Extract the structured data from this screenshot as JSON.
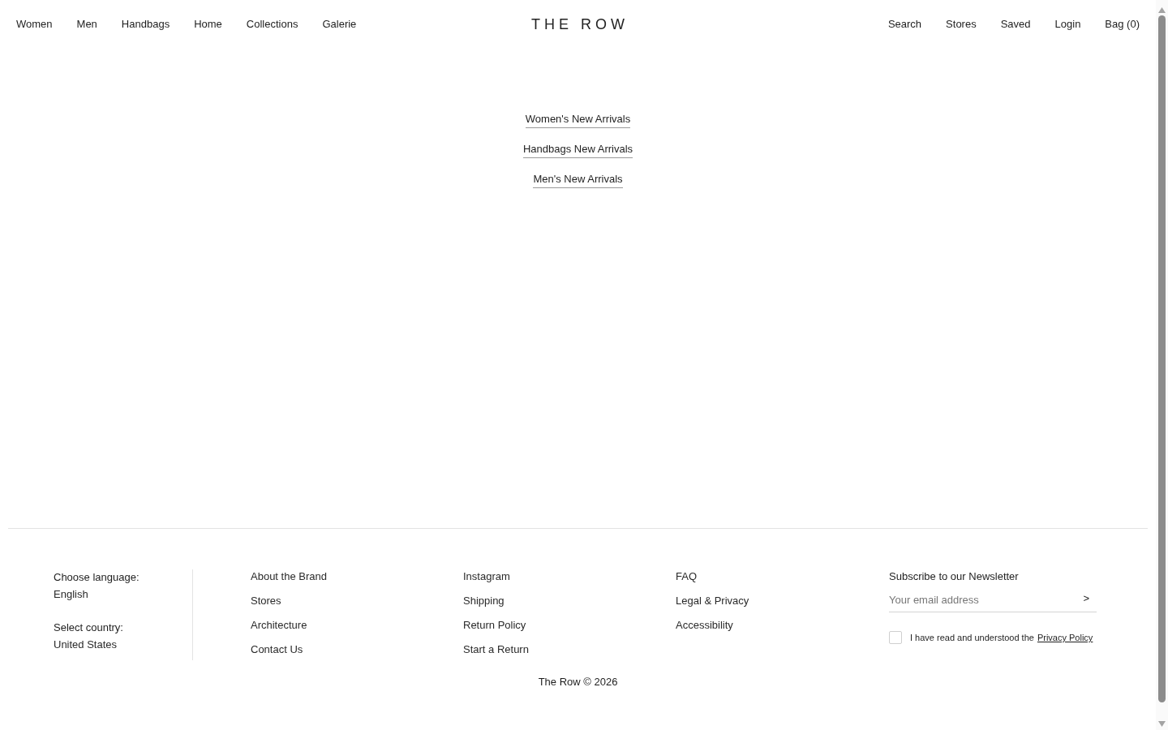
{
  "header": {
    "nav_left": [
      "Women",
      "Men",
      "Handbags",
      "Home",
      "Collections",
      "Galerie"
    ],
    "logo": "THE ROW",
    "nav_right": [
      "Search",
      "Stores",
      "Saved",
      "Login",
      "Bag (0)"
    ]
  },
  "new_arrivals_links": [
    "Women's New Arrivals",
    "Handbags New Arrivals",
    "Men's New Arrivals"
  ],
  "footer": {
    "language": {
      "label": "Choose language:",
      "value": "English"
    },
    "country": {
      "label": "Select country:",
      "value": "United States"
    },
    "columns": [
      [
        "About the Brand",
        "Stores",
        "Architecture",
        "Contact Us"
      ],
      [
        "Instagram",
        "Shipping",
        "Return Policy",
        "Start a Return"
      ],
      [
        "FAQ",
        "Legal & Privacy",
        "Accessibility"
      ]
    ],
    "newsletter": {
      "title": "Subscribe to our Newsletter",
      "placeholder": "Your email address",
      "submit": ">",
      "consent": {
        "checked": false,
        "text": "I have read and understood the",
        "link": "Privacy Policy"
      }
    },
    "copyright": "The Row © 2026"
  }
}
